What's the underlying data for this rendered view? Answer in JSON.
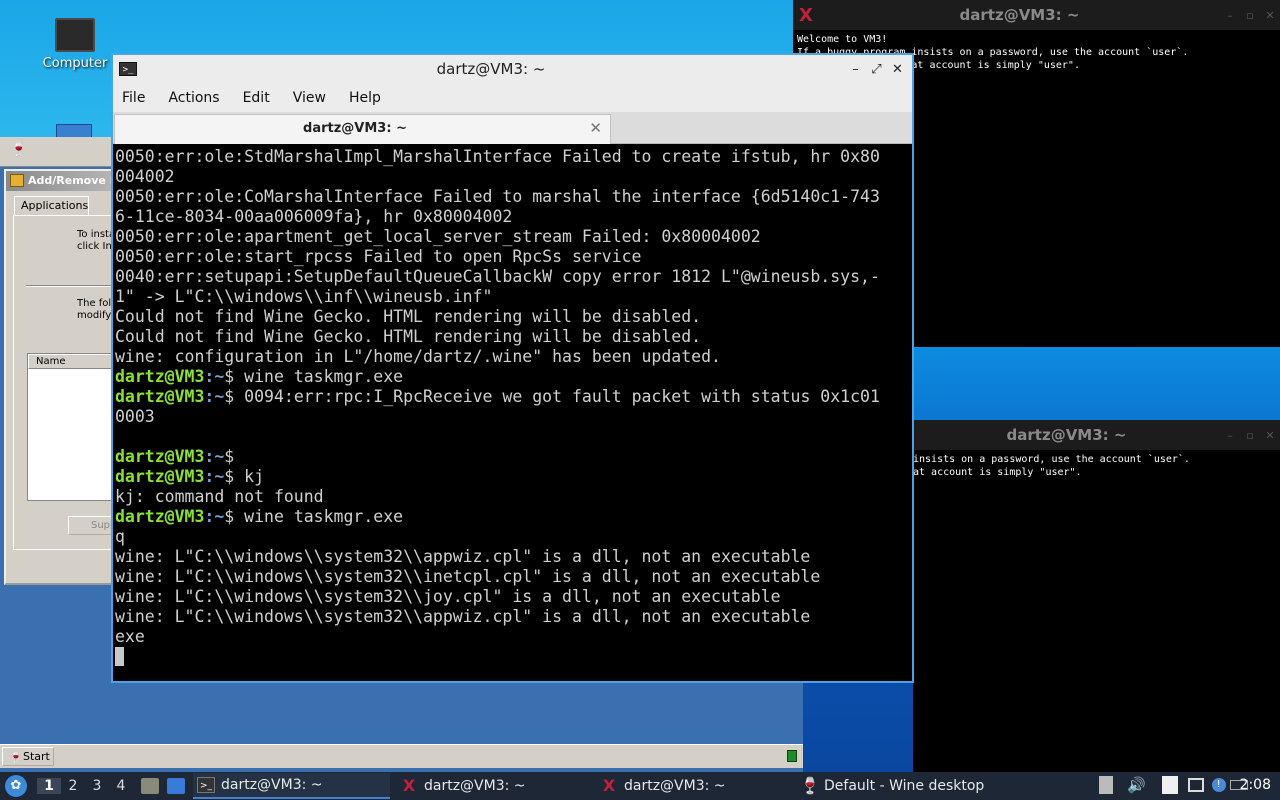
{
  "desktop": {
    "icons": [
      {
        "label": "Computer"
      }
    ]
  },
  "xterm_top": {
    "title": "dartz@VM3: ~",
    "lines": [
      "Welcome to VM3!",
      "If a buggy program insists on a password, use the account `user`.",
      "The password for that account is simply \"user\"."
    ]
  },
  "xterm_bottom": {
    "title": "dartz@VM3: ~",
    "lines": [
      "insists on a password, use the account `user`.",
      "at account is simply \"user\"."
    ]
  },
  "wine_dialog": {
    "title": "Add/Remove Pro",
    "tab": "Applications",
    "text1": [
      "To insta",
      "click Ins"
    ],
    "text2": [
      "The fol",
      "modify"
    ],
    "list_header": "Name",
    "button": "Supp",
    "start_label": "Start"
  },
  "terminal": {
    "title": "dartz@VM3: ~",
    "menu": [
      "File",
      "Actions",
      "Edit",
      "View",
      "Help"
    ],
    "tab_label": "dartz@VM3: ~",
    "prompt_user": "dartz@VM3",
    "prompt_path": ":~",
    "lines": [
      {
        "t": "0050:err:ole:StdMarshalImpl_MarshalInterface Failed to create ifstub, hr 0x80"
      },
      {
        "t": "004002"
      },
      {
        "t": "0050:err:ole:CoMarshalInterface Failed to marshal the interface {6d5140c1-743"
      },
      {
        "t": "6-11ce-8034-00aa006009fa}, hr 0x80004002"
      },
      {
        "t": "0050:err:ole:apartment_get_local_server_stream Failed: 0x80004002"
      },
      {
        "t": "0050:err:ole:start_rpcss Failed to open RpcSs service"
      },
      {
        "t": "0040:err:setupapi:SetupDefaultQueueCallbackW copy error 1812 L\"@wineusb.sys,-"
      },
      {
        "t": "1\" -> L\"C:\\\\windows\\\\inf\\\\wineusb.inf\""
      },
      {
        "t": "Could not find Wine Gecko. HTML rendering will be disabled."
      },
      {
        "t": "Could not find Wine Gecko. HTML rendering will be disabled."
      },
      {
        "t": "wine: configuration in L\"/home/dartz/.wine\" has been updated."
      },
      {
        "p": true,
        "t": "$ wine taskmgr.exe"
      },
      {
        "p": true,
        "t": "$ 0094:err:rpc:I_RpcReceive we got fault packet with status 0x1c01"
      },
      {
        "t": "0003"
      },
      {
        "t": ""
      },
      {
        "p": true,
        "t": "$"
      },
      {
        "p": true,
        "t": "$ kj"
      },
      {
        "t": "kj: command not found"
      },
      {
        "p": true,
        "t": "$ wine taskmgr.exe"
      },
      {
        "t": "q"
      },
      {
        "t": "wine: L\"C:\\\\windows\\\\system32\\\\appwiz.cpl\" is a dll, not an executable"
      },
      {
        "t": "wine: L\"C:\\\\windows\\\\system32\\\\inetcpl.cpl\" is a dll, not an executable"
      },
      {
        "t": "wine: L\"C:\\\\windows\\\\system32\\\\joy.cpl\" is a dll, not an executable"
      },
      {
        "t": "wine: L\"C:\\\\windows\\\\system32\\\\appwiz.cpl\" is a dll, not an executable"
      },
      {
        "t": "exe"
      }
    ]
  },
  "taskbar": {
    "workspaces": [
      "1",
      "2",
      "3",
      "4"
    ],
    "tasks": [
      {
        "label": "dartz@VM3: ~",
        "icon": "terminal-icon",
        "active": true
      },
      {
        "label": "dartz@VM3: ~",
        "icon": "x-logo-icon",
        "active": false
      },
      {
        "label": "dartz@VM3: ~",
        "icon": "x-logo-icon",
        "active": false
      },
      {
        "label": "Default - Wine desktop",
        "icon": "wine-glass-icon",
        "active": false
      }
    ],
    "clock": "2:08"
  }
}
